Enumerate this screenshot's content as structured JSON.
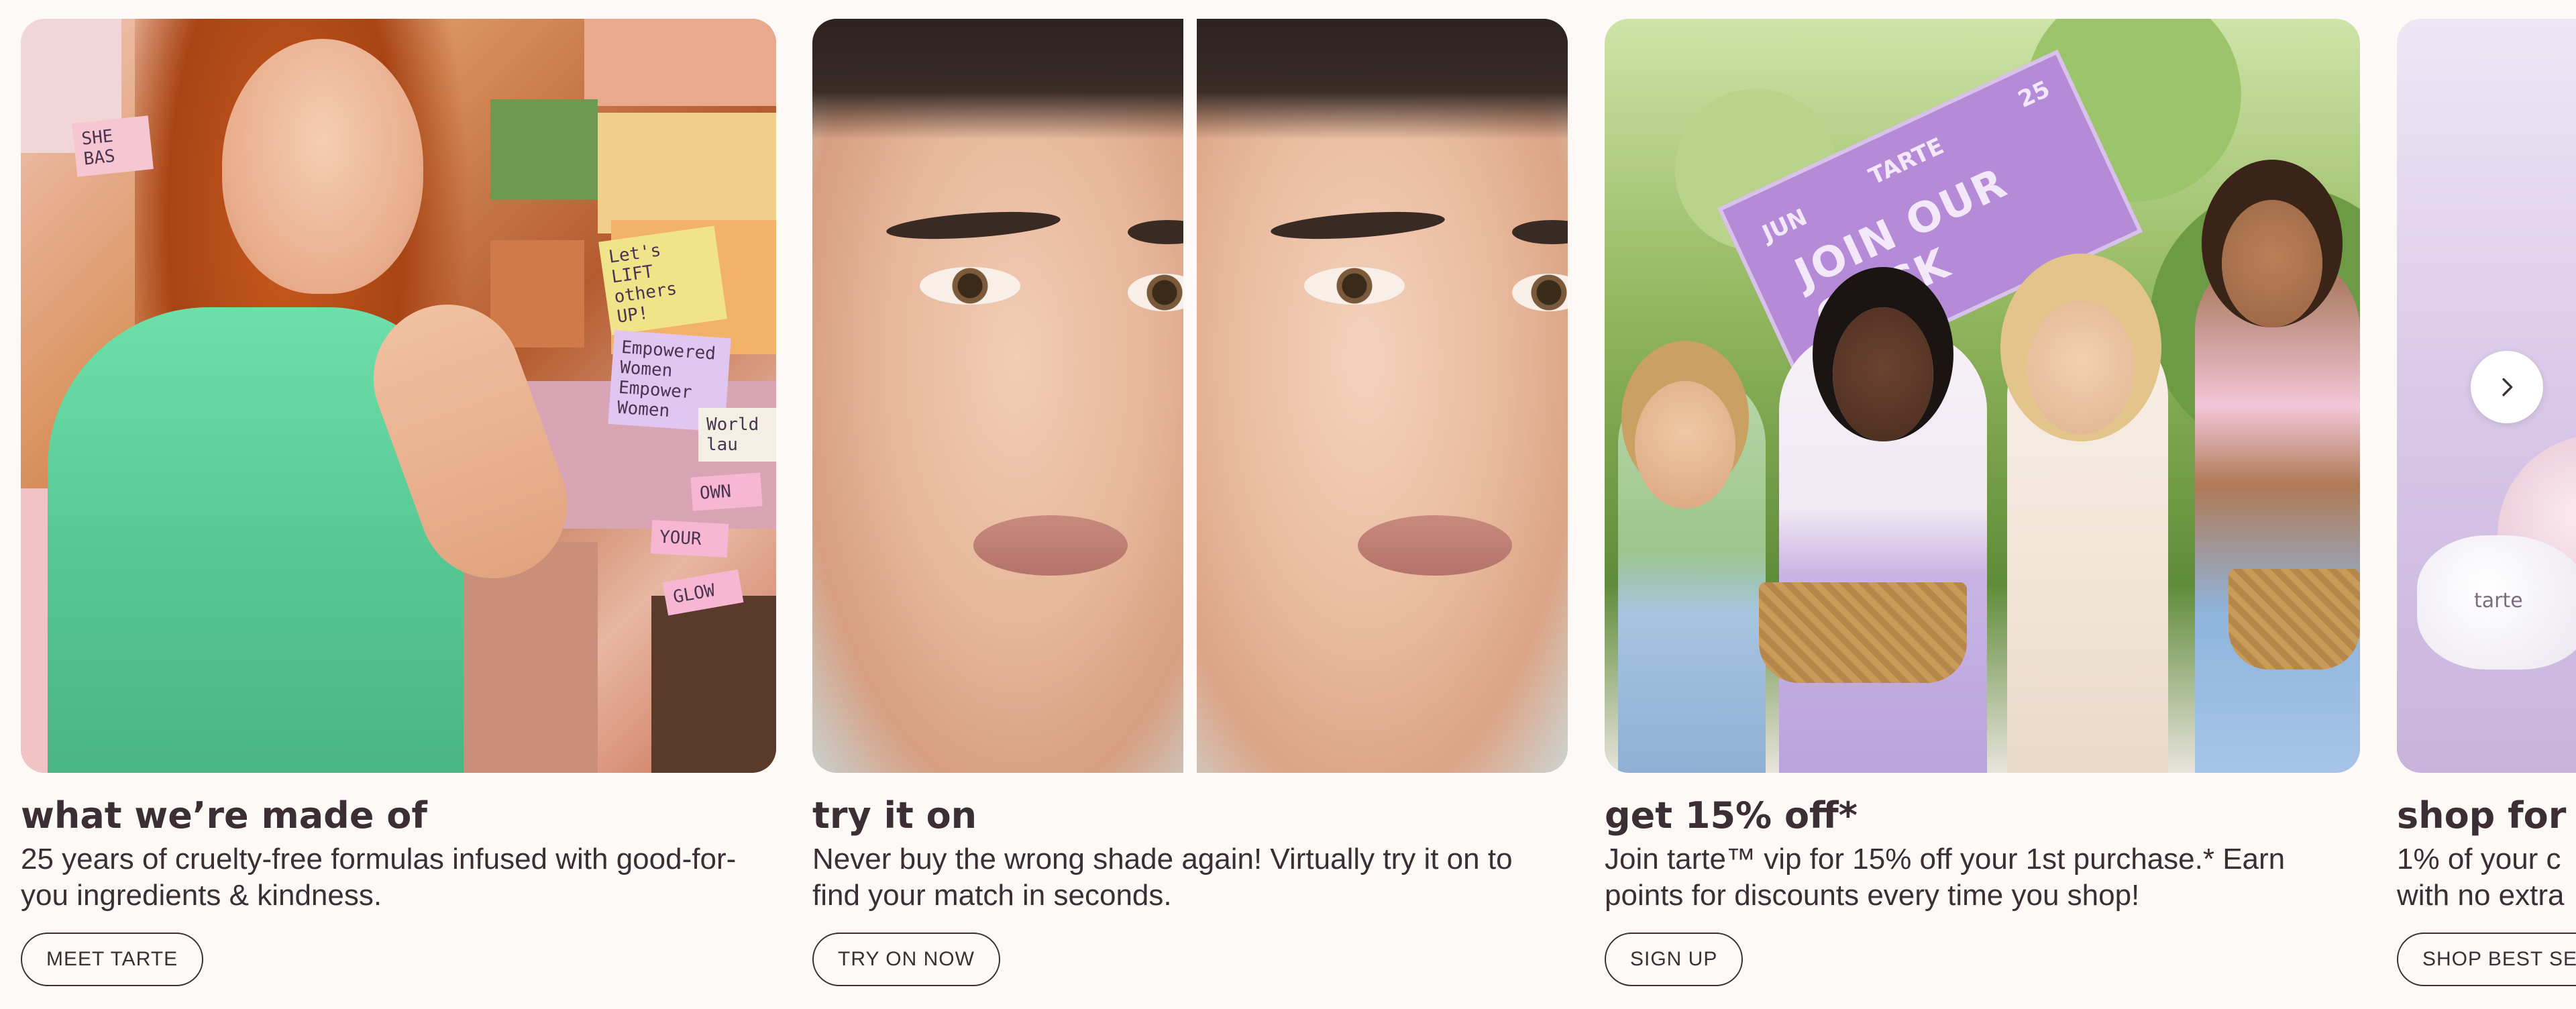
{
  "cards": [
    {
      "image_alt": "",
      "title": "what we’re made of",
      "description": "25 years of cruelty-free formulas infused with good-for-you ingredients & kindness.",
      "cta_label": "MEET TARTE",
      "notes": [
        "Let's LIFT others UP!",
        "Empowered Women Empower Women",
        "OWN",
        "YOUR",
        "GLOW",
        "World lau",
        "SHE BAS"
      ]
    },
    {
      "title": "try it on",
      "description": "Never buy the wrong shade again! Virtually try it on to find your match in seconds.",
      "cta_label": "TRY ON NOW"
    },
    {
      "title": "get 15% off*",
      "description": "Join tarte™ vip for 15% off your 1st purchase.* Earn points for discounts every time you shop!",
      "cta_label": "SIGN UP",
      "sign": {
        "text": "JOIN OUR CLICK",
        "left": "JUN",
        "middle": "TARTE",
        "corner": "25"
      }
    },
    {
      "title": "shop for",
      "description_line1": "1% of your c",
      "description_line2": "with no extra",
      "cta_label": "SHOP BEST SE",
      "product_label": "tarte"
    }
  ],
  "next_arrow_icon": "chevron-right-icon",
  "colors": {
    "background": "#fdf9f7",
    "text": "#3b2f35",
    "accent_purple": "#b58ad6",
    "dress_green": "#57c994"
  }
}
